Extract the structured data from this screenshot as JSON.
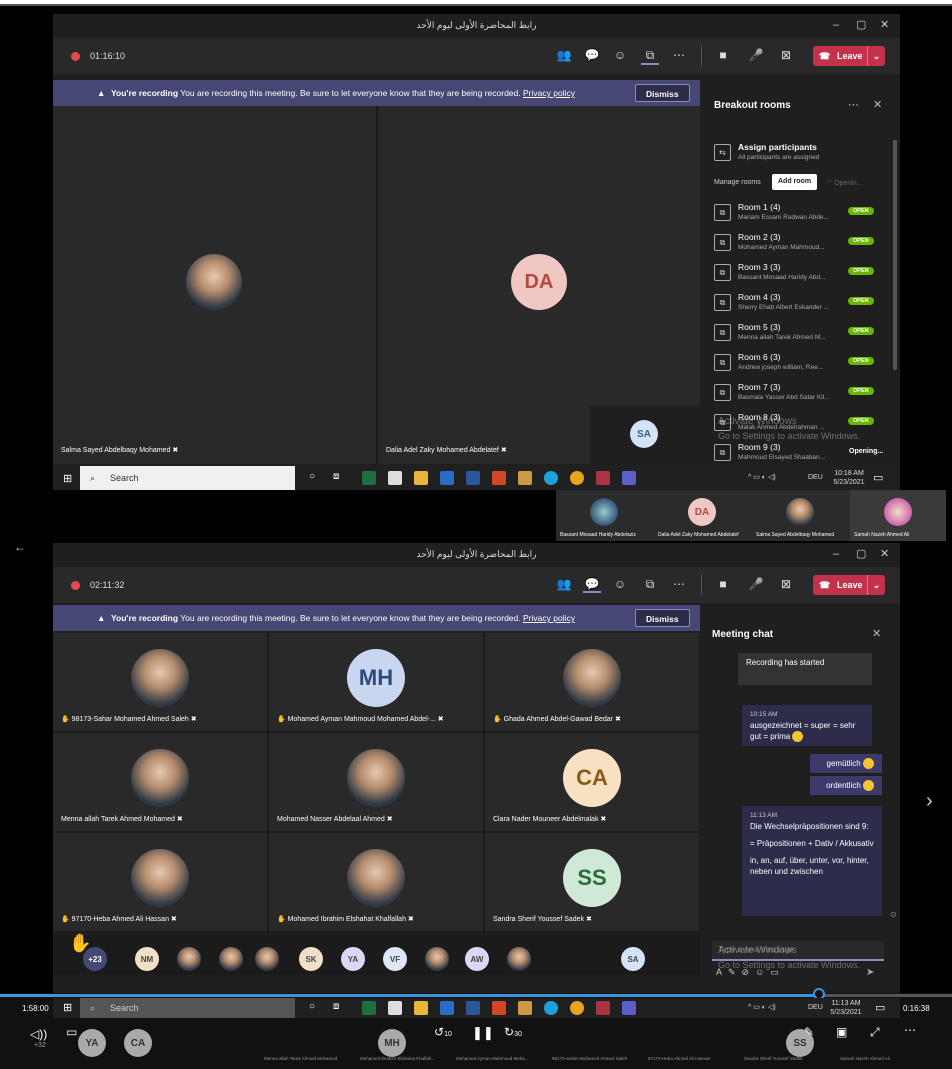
{
  "window_title": "رابط المحاضرة الأولى ليوم الأحد",
  "win_controls": {
    "minimize": "–",
    "maximize": "▢",
    "close": "✕"
  },
  "top": {
    "timer": "01:16:10",
    "leave": "Leave",
    "banner": {
      "strong": "You're recording",
      "text": "You are recording this meeting. Be sure to let everyone know that they are being recorded.",
      "link": "Privacy policy",
      "dismiss": "Dismiss"
    },
    "tiles": [
      {
        "name": "Salma Sayed Abdelbaqy Mohamed"
      },
      {
        "name": "Dalia Adel Zaky Mohamed Abdelatef",
        "initials": "DA"
      }
    ],
    "self_initials": "SA",
    "breakout": {
      "title": "Breakout rooms",
      "assign_title": "Assign participants",
      "assign_sub": "All participants are assigned",
      "manage_label": "Manage rooms",
      "add_room": "Add room",
      "opening_small": "Openin...",
      "rooms": [
        {
          "title": "Room 1 (4)",
          "sub": "Mariam Essam Radwan Abde...",
          "status": "OPEN"
        },
        {
          "title": "Room 2 (3)",
          "sub": "Mohamed Ayman Mahmoud...",
          "status": "OPEN"
        },
        {
          "title": "Room 3 (3)",
          "sub": "Bassant Mosaad Haridy Abd...",
          "status": "OPEN"
        },
        {
          "title": "Room 4 (3)",
          "sub": "Sherry Ehab Albert Eskander ...",
          "status": "OPEN"
        },
        {
          "title": "Room 5 (3)",
          "sub": "Menna allah Tarek Ahmed M...",
          "status": "OPEN"
        },
        {
          "title": "Room 6 (3)",
          "sub": "Andrew joseph william, Ree...",
          "status": "OPEN"
        },
        {
          "title": "Room 7 (3)",
          "sub": "Basmala Yasser Abd Satar Kil...",
          "status": "OPEN"
        },
        {
          "title": "Room 8 (3)",
          "sub": "Malak Ahmed Abdelrahman ...",
          "status": "OPEN"
        },
        {
          "title": "Room 9 (3)",
          "sub": "Mahmoud Elsayed Shaaban...",
          "status": "Opening..."
        }
      ]
    },
    "watermark_1": "Activate Windows",
    "watermark_2": "Go to Settings to activate Windows.",
    "taskbar": {
      "search": "Search",
      "lang": "DEU",
      "time": "10:18 AM",
      "date": "5/23/2021"
    },
    "strip": [
      {
        "name": "Bassant Mosaad Haridy Abdelaziz"
      },
      {
        "name": "Dalia Adel Zaky Mohamed Abdelatef",
        "initials": "DA"
      },
      {
        "name": "Salma Sayed Abdelbaqy Mohamed"
      },
      {
        "name": "Samah Nazeh Ahmed Ali"
      }
    ]
  },
  "bottom": {
    "timer": "02:11:32",
    "leave": "Leave",
    "banner": {
      "strong": "You're recording",
      "text": "You are recording this meeting. Be sure to let everyone know that they are being recorded.",
      "link": "Privacy policy",
      "dismiss": "Dismiss"
    },
    "grid": [
      {
        "name": "98173-Sahar Mohamed Ahmed Saleh",
        "hand": true
      },
      {
        "name": "Mohamed Ayman Mahmoud Mohamed Abdel-...",
        "initials": "MH",
        "hand": true
      },
      {
        "name": "Ghada Ahmed Abdel-Gawad Bedar",
        "hand": true
      },
      {
        "name": "Menna allah Tarek Ahmed Mohamed",
        "hand": false
      },
      {
        "name": "Mohamed Nasser Abdelaal Ahmed",
        "hand": false
      },
      {
        "name": "Clara Nader Mouneer Abdelmalak",
        "initials": "CA",
        "hand": false
      },
      {
        "name": "97170-Heba Ahmed Ali Hassan",
        "hand": true
      },
      {
        "name": "Mohamed Ibrahim Elshahat Khalfallah",
        "hand": true
      },
      {
        "name": "Sandra Sherif Youssef Sadek",
        "initials": "SS",
        "hand": false
      }
    ],
    "overflow_count": "+23",
    "strip_initials": [
      "NM",
      "SK",
      "YA",
      "VF",
      "AW",
      "SA"
    ],
    "chat": {
      "title": "Meeting chat",
      "system": "Recording has started",
      "msg1_time": "10:15 AM",
      "msg1_text": "ausgezeichnet = super = sehr gut = prima",
      "me1": "gemütlich",
      "me2": "ordentlich",
      "msg2_time": "11:13 AM",
      "msg2_text": "Die Wechselpräpositionen sind 9:",
      "msg2_b": "= Präpositionen + Dativ / Akkusativ",
      "msg2_c": "in, an, auf, über, unter, vor, hinter, neben und zwischen",
      "compose_placeholder": "Type a new message"
    },
    "taskbar": {
      "search": "Search",
      "lang": "DEU",
      "time": "11:13 AM",
      "date": "5/23/2021"
    },
    "player": {
      "elapsed": "1:58:00",
      "remaining": "0:16:38",
      "progress": 0.86,
      "rewind": "10",
      "forward": "30",
      "volume_badge": "+32"
    },
    "player_strip": {
      "initials": [
        "YA",
        "CA",
        "MH",
        "SS"
      ],
      "names": [
        "Menna allah Tarek Ahmed Mohamed",
        "Mohamed Ibrahim Elshahat Khalfall...",
        "Mohamed Ayman Mahmoud Moha...",
        "98173-Sahar Mohamed Ahmed Saleh",
        "97170-Heba Ahmed Ali Hassan",
        "Sandra Sherif Youssef Sadek",
        "Samah Nazeh Ahmed Ali"
      ]
    }
  },
  "colors": {
    "teams_purple": "#464775",
    "leave_red": "#c4314b",
    "open_green": "#6bb700",
    "chat_bubble": "#2d2c4b"
  }
}
